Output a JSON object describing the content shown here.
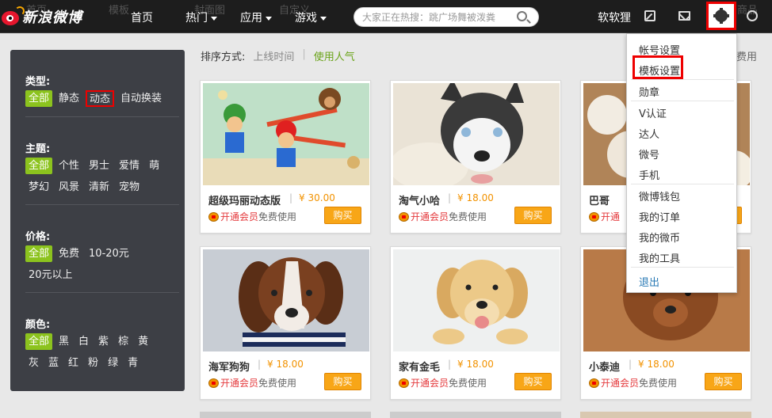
{
  "header": {
    "logo_text": "新浪微博",
    "ghost_items": [
      "首页",
      "模板",
      "封面图",
      "自定义",
      "商品"
    ],
    "nav": [
      "首页",
      "热门",
      "应用",
      "游戏"
    ],
    "search_placeholder": "大家正在热搜：跳广场舞被泼粪",
    "username": "软软狸"
  },
  "sidebar": {
    "groups": [
      {
        "title": "类型:",
        "options": [
          "全部",
          "静态",
          "动态",
          "自动换装"
        ]
      },
      {
        "title": "主题:",
        "options": [
          "全部",
          "个性",
          "男士",
          "爱情",
          "萌",
          "梦幻",
          "风景",
          "清新",
          "宠物"
        ]
      },
      {
        "title": "价格:",
        "options": [
          "全部",
          "免费",
          "10-20元",
          "20元以上"
        ]
      },
      {
        "title": "颜色:",
        "options": [
          "全部",
          "黑",
          "白",
          "紫",
          "棕",
          "黄",
          "灰",
          "蓝",
          "红",
          "粉",
          "绿",
          "青"
        ]
      }
    ]
  },
  "sort": {
    "label": "排序方式:",
    "option1": "上线时间",
    "separator": "|",
    "option2": "使用人气",
    "free_use": "费用"
  },
  "cards": [
    {
      "name": "超级玛丽动态版",
      "price": "¥ 30.00",
      "vip_link": "开通会员",
      "vip_free": "免费使用",
      "buy": "购买"
    },
    {
      "name": "淘气小哈",
      "price": "¥ 18.00",
      "vip_link": "开通会员",
      "vip_free": "免费使用",
      "buy": "购买"
    },
    {
      "name": "巴哥",
      "price": "",
      "vip_link": "开通",
      "vip_free": "",
      "buy": "购买"
    },
    {
      "name": "海军狗狗",
      "price": "¥ 18.00",
      "vip_link": "开通会员",
      "vip_free": "免费使用",
      "buy": "购买"
    },
    {
      "name": "家有金毛",
      "price": "¥ 18.00",
      "vip_link": "开通会员",
      "vip_free": "免费使用",
      "buy": "购买"
    },
    {
      "name": "小泰迪",
      "price": "¥ 18.00",
      "vip_link": "开通会员",
      "vip_free": "免费使用",
      "buy": "购买"
    }
  ],
  "dropdown": {
    "items": [
      "帐号设置",
      "模板设置",
      "勋章",
      "V认证",
      "达人",
      "微号",
      "手机",
      "微博钱包",
      "我的订单",
      "我的微币",
      "我的工具"
    ],
    "logout": "退出"
  },
  "colors": {
    "accent_green": "#8cc31e",
    "buy_orange": "#f8a617",
    "highlight_red": "#e00000",
    "topbar": "#1d1d1d",
    "sidebar": "#3d3f45"
  }
}
